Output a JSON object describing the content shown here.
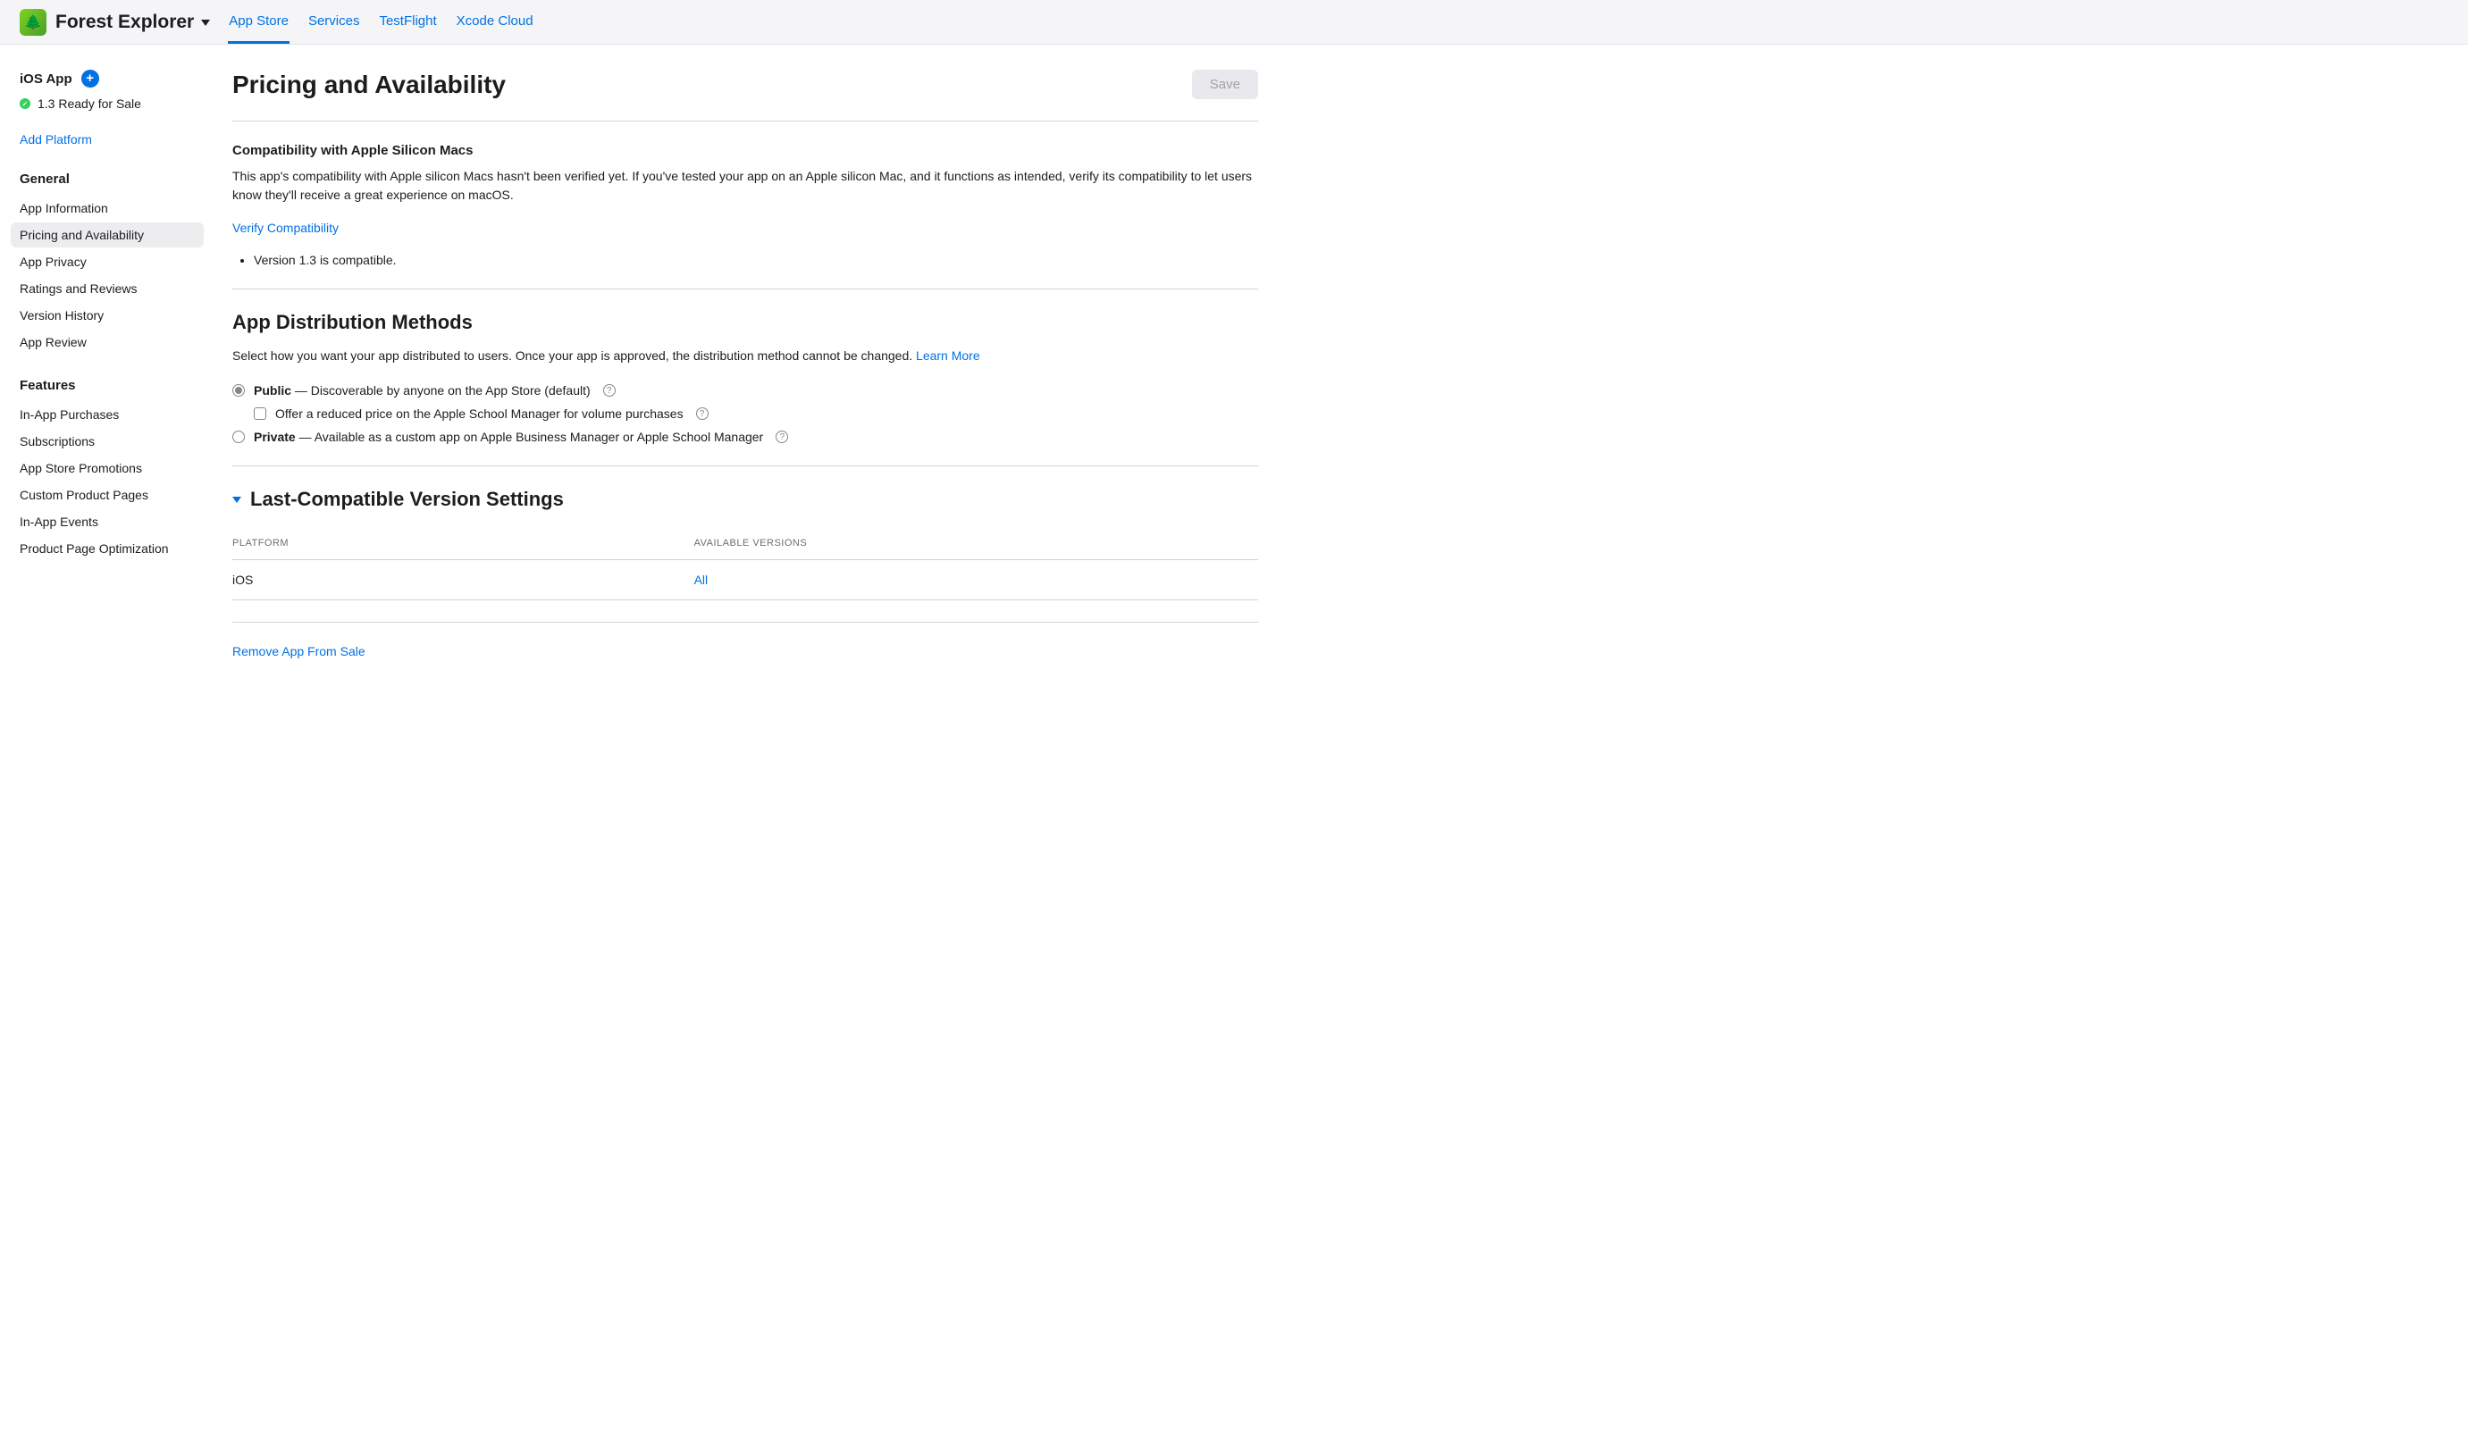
{
  "header": {
    "app_name": "Forest Explorer",
    "tabs": [
      "App Store",
      "Services",
      "TestFlight",
      "Xcode Cloud"
    ],
    "active_tab": 0
  },
  "sidebar": {
    "platform_title": "iOS App",
    "status_text": "1.3 Ready for Sale",
    "add_platform": "Add Platform",
    "groups": [
      {
        "title": "General",
        "items": [
          "App Information",
          "Pricing and Availability",
          "App Privacy",
          "Ratings and Reviews",
          "Version History",
          "App Review"
        ],
        "active_index": 1
      },
      {
        "title": "Features",
        "items": [
          "In-App Purchases",
          "Subscriptions",
          "App Store Promotions",
          "Custom Product Pages",
          "In-App Events",
          "Product Page Optimization"
        ],
        "active_index": -1
      }
    ]
  },
  "main": {
    "page_title": "Pricing and Availability",
    "save_label": "Save",
    "compat": {
      "heading": "Compatibility with Apple Silicon Macs",
      "body": "This app's compatibility with Apple silicon Macs hasn't been verified yet. If you've tested your app on an Apple silicon Mac, and it functions as intended, verify its compatibility to let users know they'll receive a great experience on macOS.",
      "verify_link": "Verify Compatibility",
      "bullets": [
        "Version 1.3 is compatible."
      ]
    },
    "distribution": {
      "heading": "App Distribution Methods",
      "body_pre": "Select how you want your app distributed to users. Once your app is approved, the distribution method cannot be changed. ",
      "learn_more": "Learn More",
      "options": {
        "public_label": "Public",
        "public_desc": " — Discoverable by anyone on the App Store (default)",
        "reduced_label": "Offer a reduced price on the Apple School Manager for volume purchases",
        "private_label": "Private",
        "private_desc": " — Available as a custom app on Apple Business Manager or Apple School Manager"
      }
    },
    "last_compat": {
      "heading": "Last-Compatible Version Settings",
      "col_platform": "PLATFORM",
      "col_versions": "AVAILABLE VERSIONS",
      "rows": [
        {
          "platform": "iOS",
          "versions": "All"
        }
      ]
    },
    "remove_link": "Remove App From Sale"
  }
}
